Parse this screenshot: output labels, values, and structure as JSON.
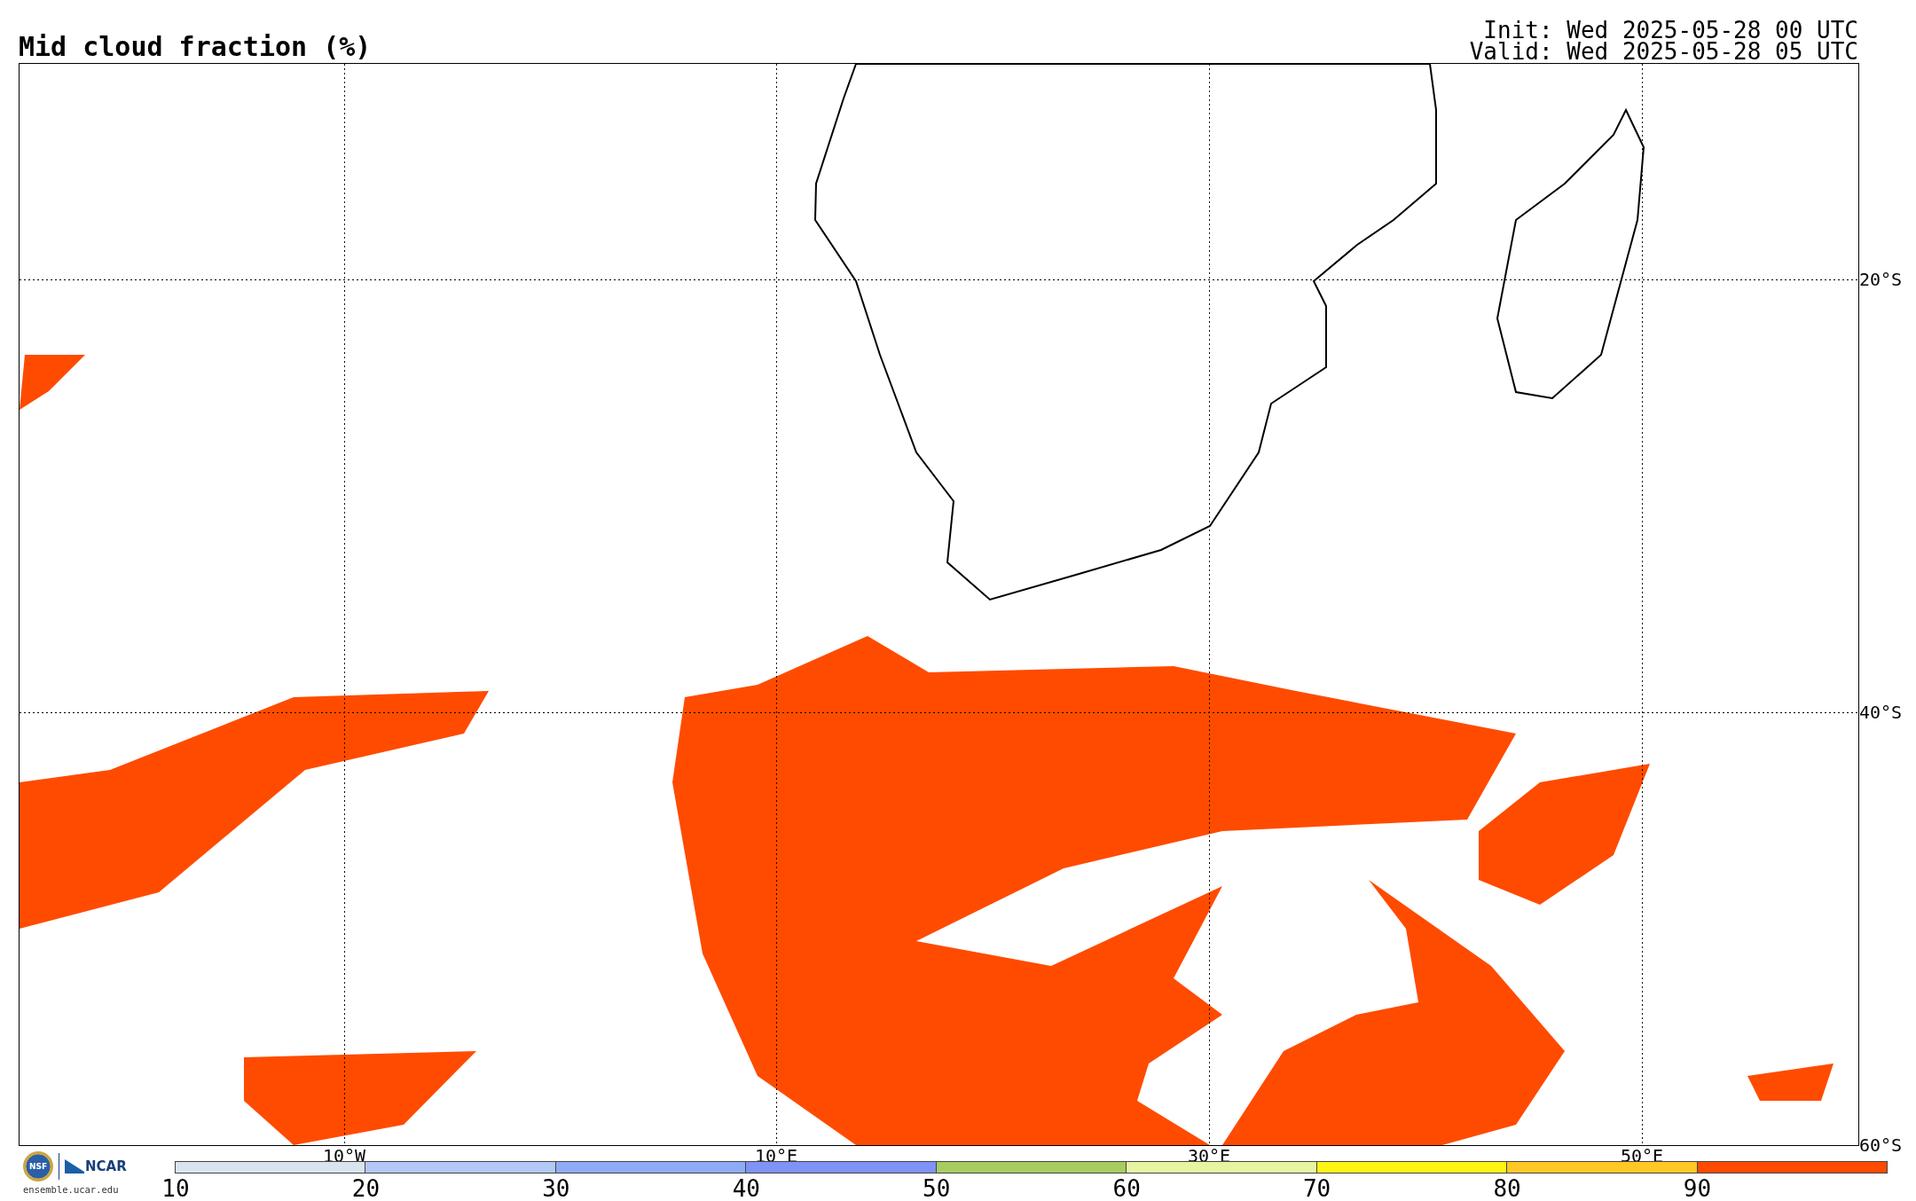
{
  "header": {
    "title": "Mid cloud fraction (%)",
    "init": "Init: Wed 2025-05-28 00 UTC",
    "valid": "Valid: Wed 2025-05-28 05 UTC"
  },
  "map": {
    "longitude_labels": [
      "10°W",
      "10°E",
      "30°E",
      "50°E"
    ],
    "latitude_labels": [
      "20°S",
      "40°S",
      "60°S"
    ]
  },
  "legend": {
    "bins": [
      {
        "label": "10",
        "color": "#d9e4ef"
      },
      {
        "label": "20",
        "color": "#b4c8f6"
      },
      {
        "label": "30",
        "color": "#8eacf6"
      },
      {
        "label": "40",
        "color": "#7f92f6"
      },
      {
        "label": "50",
        "color": "#a6cc62"
      },
      {
        "label": "60",
        "color": "#e6f5a2"
      },
      {
        "label": "70",
        "color": "#fff514"
      },
      {
        "label": "80",
        "color": "#ffc826"
      },
      {
        "label": "90",
        "color": "#ff4b00"
      }
    ]
  },
  "footer": {
    "logos": [
      "NSF",
      "NCAR"
    ],
    "site": "ensemble.ucar.edu"
  }
}
